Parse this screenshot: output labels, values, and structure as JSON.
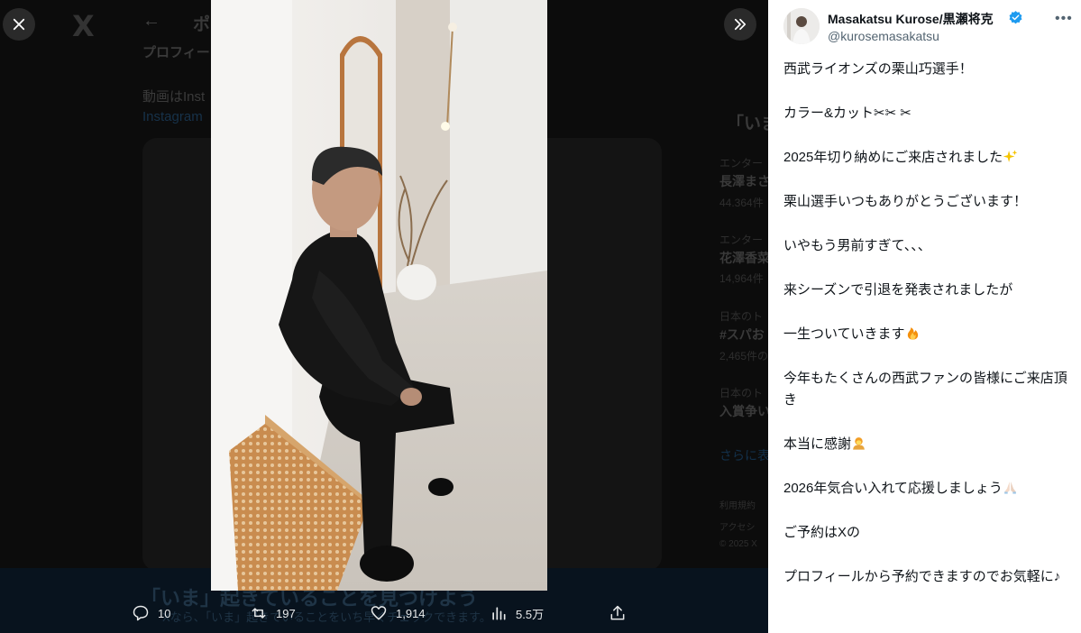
{
  "background": {
    "x_logo": "X",
    "back_arrow": "←",
    "title_partial": "ポ",
    "profile_line": "プロフィー",
    "video_line": "動画はInst",
    "instagram_link": "Instagram",
    "trends_title": "「いま",
    "trend_items": [
      {
        "category": "エンター",
        "name": "長澤まさ",
        "count": "44.364件"
      },
      {
        "category": "エンター",
        "name": "花澤香菜",
        "count": "14,964件"
      },
      {
        "category": "日本のト",
        "name": "#スパお",
        "count": "2,465件の"
      },
      {
        "category": "日本のト",
        "name": "入賞争い",
        "count": ""
      }
    ],
    "show_more": "さらに表",
    "footer_lines": [
      "利用規約",
      "アクセシ",
      "© 2025 X"
    ],
    "bottom_banner_title": "「いま」起きていることを見つけよう",
    "bottom_banner_sub": "Xなら、「いま」起きていることをいち早くチェックできます。"
  },
  "viewer": {
    "close_icon": "close-icon",
    "expand_icon": "double-chevron-right-icon",
    "media_label": "Photo"
  },
  "actions": {
    "replies": "10",
    "reposts": "197",
    "likes": "1,914",
    "views": "5.5万"
  },
  "post": {
    "author_name": "Masakatsu Kurose/黒瀬将克",
    "author_handle": "@kurosemasakatsu",
    "verified": true,
    "more_label": "•••",
    "paragraphs": [
      {
        "text": "西武ライオンズの栗山巧選手！",
        "emoji": ""
      },
      {
        "text": "カラー&カット✂︎✂︎ ✂︎",
        "emoji": ""
      },
      {
        "text": "2025年切り納めにご来店されました",
        "emoji": "sparkles"
      },
      {
        "text": "栗山選手いつもありがとうございます！",
        "emoji": ""
      },
      {
        "text": "いやもう男前すぎて、、、",
        "emoji": ""
      },
      {
        "text": "来シーズンで引退を発表されましたが",
        "emoji": ""
      },
      {
        "text": "一生ついていきます",
        "emoji": "fire"
      },
      {
        "text": "今年もたくさんの西武ファンの皆様にご来店頂き",
        "emoji": ""
      },
      {
        "text": "本当に感謝",
        "emoji": "bowing"
      },
      {
        "text": "2026年気合い入れて応援しましょう",
        "emoji": "folded-hands"
      },
      {
        "text": "ご予約はXの",
        "emoji": ""
      },
      {
        "text": "プロフィールから予約できますのでお気軽に♪",
        "emoji": ""
      }
    ]
  },
  "colors": {
    "accent": "#1d9bf0",
    "panel_bg": "#ffffff",
    "text_primary": "#0f1419",
    "text_secondary": "#536471",
    "viewer_bg": "#000000"
  }
}
